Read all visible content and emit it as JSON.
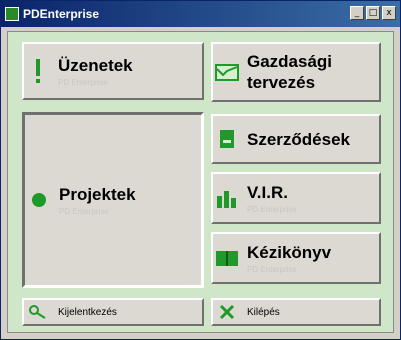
{
  "window": {
    "title": "PDEnterprise"
  },
  "buttons": {
    "uzenetek": {
      "label": "Üzenetek",
      "sub": "PD Enterprise"
    },
    "gazdasagi": {
      "label_line1": "Gazdasági",
      "label_line2": "tervezés"
    },
    "projektek": {
      "label": "Projektek",
      "sub": "PD Enterprise"
    },
    "szerzodesek": {
      "label": "Szerződések"
    },
    "vir": {
      "label": "V.I.R.",
      "sub": "PD Enterprise"
    },
    "kezikonyv": {
      "label": "Kézikönyv",
      "sub": "PD Enterprise"
    },
    "kijelentkezes": {
      "label": "Kijelentkezés"
    },
    "kilepes": {
      "label": "Kilépés"
    }
  },
  "colors": {
    "accent_green": "#1f9a2a",
    "content_bg": "#cfe6c9",
    "title_bar": "#0a246a"
  }
}
